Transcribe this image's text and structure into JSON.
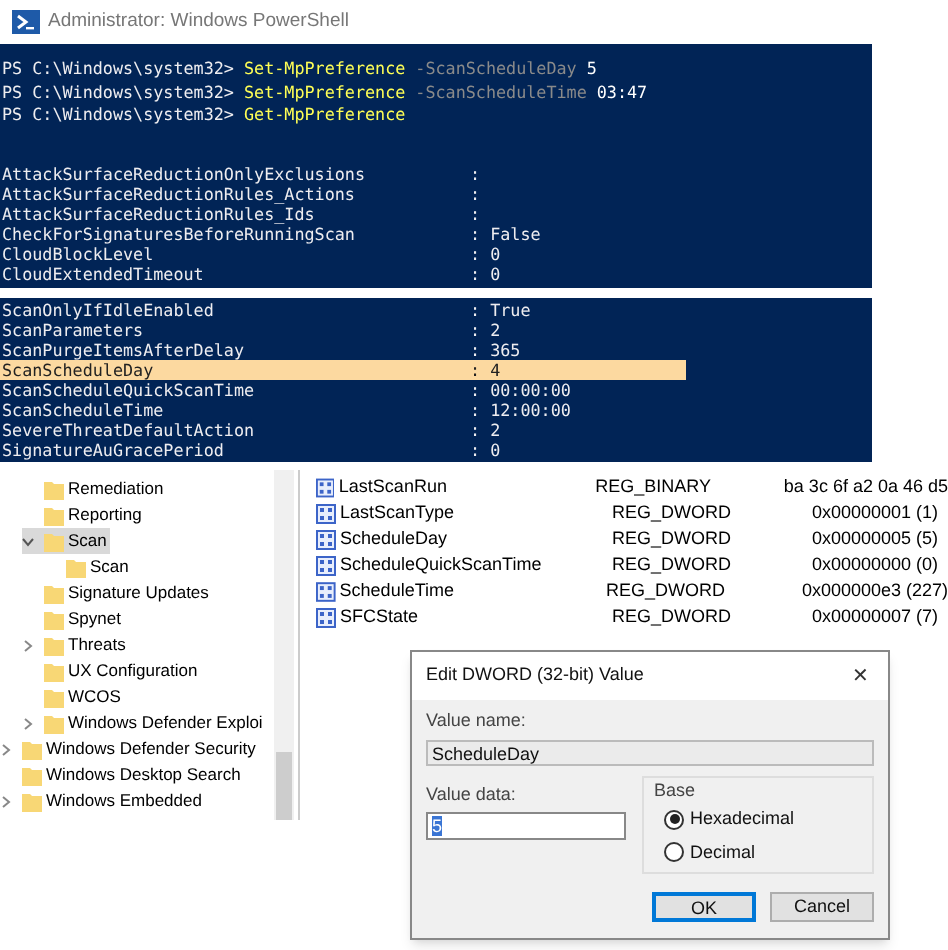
{
  "window": {
    "title": "Administrator: Windows PowerShell"
  },
  "commands": [
    {
      "prompt": "PS C:\\Windows\\system32>",
      "cmdlet": "Set-MpPreference",
      "parameter": "-ScanScheduleDay",
      "argument": "5"
    },
    {
      "prompt": "PS C:\\Windows\\system32>",
      "cmdlet": "Set-MpPreference",
      "parameter": "-ScanScheduleTime",
      "argument": "03:47"
    },
    {
      "prompt": "PS C:\\Windows\\system32>",
      "cmdlet": "Get-MpPreference"
    }
  ],
  "output_top": [
    {
      "name": "AttackSurfaceReductionOnlyExclusions",
      "value": ":"
    },
    {
      "name": "AttackSurfaceReductionRules_Actions",
      "value": ":"
    },
    {
      "name": "AttackSurfaceReductionRules_Ids",
      "value": ":"
    },
    {
      "name": "CheckForSignaturesBeforeRunningScan",
      "value": ": False"
    },
    {
      "name": "CloudBlockLevel",
      "value": ": 0"
    },
    {
      "name": "CloudExtendedTimeout",
      "value": ": 0"
    }
  ],
  "output_bottom": [
    {
      "name": "ScanOnlyIfIdleEnabled",
      "value": ": True",
      "highlighted": false
    },
    {
      "name": "ScanParameters",
      "value": ": 2",
      "highlighted": false
    },
    {
      "name": "ScanPurgeItemsAfterDelay",
      "value": ": 365",
      "highlighted": false
    },
    {
      "name": "ScanScheduleDay",
      "value": ": 4",
      "highlighted": true
    },
    {
      "name": "ScanScheduleQuickScanTime",
      "value": ": 00:00:00",
      "highlighted": false
    },
    {
      "name": "ScanScheduleTime",
      "value": ": 12:00:00",
      "highlighted": false
    },
    {
      "name": "SevereThreatDefaultAction",
      "value": ": 2",
      "highlighted": false
    },
    {
      "name": "SignatureAuGracePeriod",
      "value": ": 0",
      "highlighted": false
    }
  ],
  "tree": [
    {
      "children": [
        {
          "label": "Remediation",
          "expandable": false,
          "selected": false
        },
        {
          "label": "Reporting",
          "expandable": false,
          "selected": false
        },
        {
          "label": "Scan",
          "expandable": true,
          "expanded": true,
          "selected": true,
          "children": [
            {
              "label": "Scan",
              "expandable": false,
              "selected": false
            }
          ]
        },
        {
          "label": "Signature Updates",
          "expandable": false,
          "selected": false
        },
        {
          "label": "Spynet",
          "expandable": false,
          "selected": false
        },
        {
          "label": "Threats",
          "expandable": true,
          "expanded": false,
          "selected": false
        },
        {
          "label": "UX Configuration",
          "expandable": false,
          "selected": false
        },
        {
          "label": "WCOS",
          "expandable": false,
          "selected": false
        },
        {
          "label": "Windows Defender Exploi",
          "expandable": true,
          "expanded": false,
          "selected": false
        }
      ]
    },
    {
      "label": "Windows Defender Security",
      "expandable": true,
      "expanded": false,
      "selected": false
    },
    {
      "label": "Windows Desktop Search",
      "expandable": false,
      "selected": false
    },
    {
      "label": "Windows Embedded",
      "expandable": true,
      "expanded": false,
      "selected": false
    }
  ],
  "values": [
    {
      "name": "LastScanRun",
      "type": "REG_BINARY",
      "data": "ba 3c 6f a2 0a 46 d5"
    },
    {
      "name": "LastScanType",
      "type": "REG_DWORD",
      "data": "0x00000001 (1)"
    },
    {
      "name": "ScheduleDay",
      "type": "REG_DWORD",
      "data": "0x00000005 (5)"
    },
    {
      "name": "ScheduleQuickScanTime",
      "type": "REG_DWORD",
      "data": "0x00000000 (0)"
    },
    {
      "name": "ScheduleTime",
      "type": "REG_DWORD",
      "data": "0x000000e3 (227)"
    },
    {
      "name": "SFCState",
      "type": "REG_DWORD",
      "data": "0x00000007 (7)"
    }
  ],
  "dialog": {
    "title": "Edit DWORD (32-bit) Value",
    "close": "✕",
    "value_name_label": "Value name:",
    "value_name": "ScheduleDay",
    "value_data_label": "Value data:",
    "value_data": "5",
    "base_label": "Base",
    "bases": [
      {
        "label": "Hexadecimal",
        "selected": true
      },
      {
        "label": "Decimal",
        "selected": false
      }
    ],
    "buttons": [
      {
        "label": "OK",
        "focused": true
      },
      {
        "label": "Cancel",
        "focused": false
      }
    ]
  }
}
